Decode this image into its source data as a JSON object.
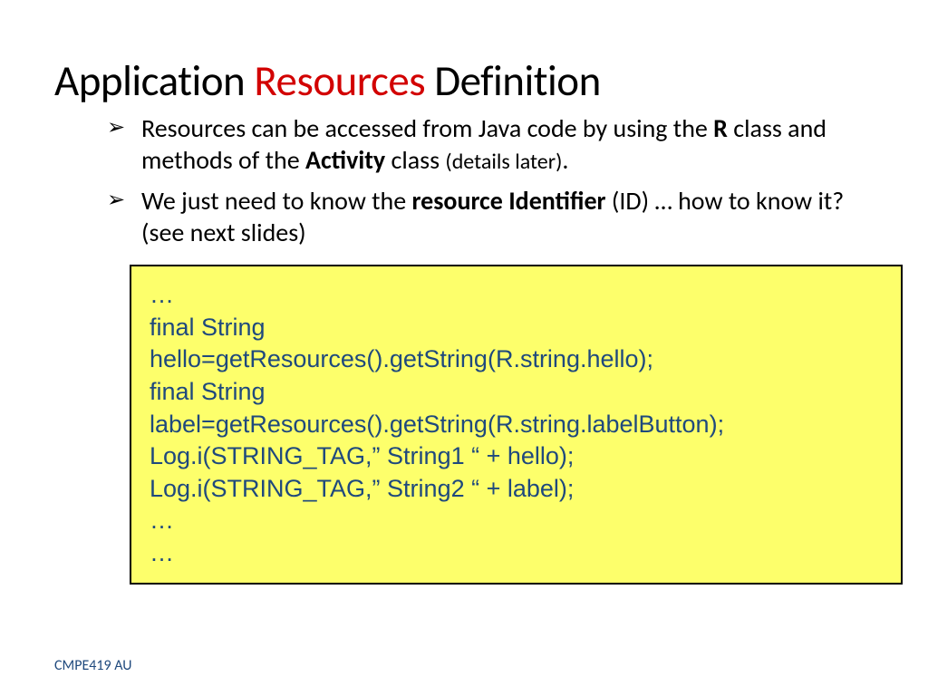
{
  "title": {
    "part1": "Application ",
    "part2": "Resources",
    "part3": " Definition"
  },
  "bullets": [
    {
      "segments": [
        {
          "t": "Resources can be accessed from Java code by using the ",
          "b": false,
          "s": false
        },
        {
          "t": "R",
          "b": true,
          "s": false
        },
        {
          "t": " class and methods of the ",
          "b": false,
          "s": false
        },
        {
          "t": "Activity",
          "b": true,
          "s": false
        },
        {
          "t": " class ",
          "b": false,
          "s": false
        },
        {
          "t": "(details later)",
          "b": false,
          "s": true
        },
        {
          "t": ".",
          "b": false,
          "s": false
        }
      ]
    },
    {
      "segments": [
        {
          "t": "We just need to know the ",
          "b": false,
          "s": false
        },
        {
          "t": "resource Identifier",
          "b": true,
          "s": false
        },
        {
          "t": " (ID) … how to know it? (see next slides)",
          "b": false,
          "s": false
        }
      ]
    }
  ],
  "code": [
    "…",
    "final String",
    "hello=getResources().getString(R.string.hello);",
    "final String",
    "label=getResources().getString(R.string.labelButton);",
    "Log.i(STRING_TAG,” String1 “ + hello);",
    "Log.i(STRING_TAG,” String2 “ + label);",
    "…",
    "…"
  ],
  "footer": "CMPE419 AU"
}
